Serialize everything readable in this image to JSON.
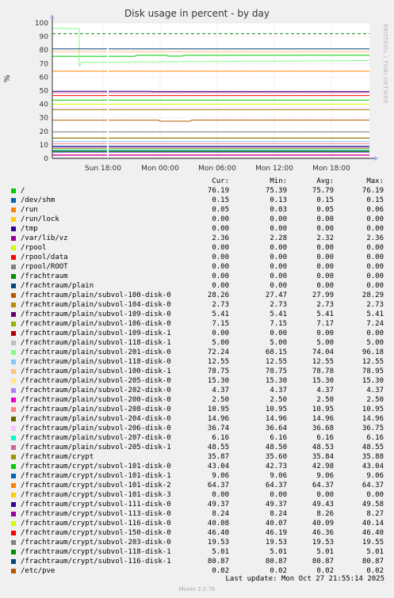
{
  "chart_data": {
    "type": "line",
    "title": "Disk usage in percent - by day",
    "ylabel": "%",
    "ylim": [
      0,
      100
    ],
    "y_ticks": [
      0,
      10,
      20,
      30,
      40,
      50,
      60,
      70,
      80,
      90,
      100
    ],
    "x_ticks": [
      "Sun 18:00",
      "Mon 00:00",
      "Mon 06:00",
      "Mon 12:00",
      "Mon 18:00"
    ],
    "grid": true,
    "side_label": "RRDTOOL / TOBI OETIKER",
    "columns": [
      "Cur:",
      "Min:",
      "Avg:",
      "Max:"
    ],
    "series": [
      {
        "name": "/",
        "color": "#00cc00",
        "cur": "76.19",
        "min": "75.39",
        "avg": "75.79",
        "max": "76.19"
      },
      {
        "name": "/dev/shm",
        "color": "#0066b3",
        "cur": "0.15",
        "min": "0.13",
        "avg": "0.15",
        "max": "0.15"
      },
      {
        "name": "/run",
        "color": "#ff8000",
        "cur": "0.05",
        "min": "0.03",
        "avg": "0.05",
        "max": "0.06"
      },
      {
        "name": "/run/lock",
        "color": "#ffcc00",
        "cur": "0.00",
        "min": "0.00",
        "avg": "0.00",
        "max": "0.00"
      },
      {
        "name": "/tmp",
        "color": "#330099",
        "cur": "0.00",
        "min": "0.00",
        "avg": "0.00",
        "max": "0.00"
      },
      {
        "name": "/var/lib/vz",
        "color": "#990099",
        "cur": "2.36",
        "min": "2.28",
        "avg": "2.32",
        "max": "2.36"
      },
      {
        "name": "/rpool",
        "color": "#ccff00",
        "cur": "0.00",
        "min": "0.00",
        "avg": "0.00",
        "max": "0.00"
      },
      {
        "name": "/rpool/data",
        "color": "#ff0000",
        "cur": "0.00",
        "min": "0.00",
        "avg": "0.00",
        "max": "0.00"
      },
      {
        "name": "/rpool/ROOT",
        "color": "#808080",
        "cur": "0.00",
        "min": "0.00",
        "avg": "0.00",
        "max": "0.00"
      },
      {
        "name": "/frachtraum",
        "color": "#008f00",
        "cur": "0.00",
        "min": "0.00",
        "avg": "0.00",
        "max": "0.00"
      },
      {
        "name": "/frachtraum/plain",
        "color": "#00487d",
        "cur": "0.00",
        "min": "0.00",
        "avg": "0.00",
        "max": "0.00"
      },
      {
        "name": "/frachtraum/plain/subvol-100-disk-0",
        "color": "#b35a00",
        "cur": "28.26",
        "min": "27.47",
        "avg": "27.99",
        "max": "28.29"
      },
      {
        "name": "/frachtraum/plain/subvol-104-disk-0",
        "color": "#b38f00",
        "cur": "2.73",
        "min": "2.73",
        "avg": "2.73",
        "max": "2.73"
      },
      {
        "name": "/frachtraum/plain/subvol-109-disk-0",
        "color": "#6b006b",
        "cur": "5.41",
        "min": "5.41",
        "avg": "5.41",
        "max": "5.41"
      },
      {
        "name": "/frachtraum/plain/subvol-106-disk-0",
        "color": "#8fb300",
        "cur": "7.15",
        "min": "7.15",
        "avg": "7.17",
        "max": "7.24"
      },
      {
        "name": "/frachtraum/plain/subvol-109-disk-1",
        "color": "#b30000",
        "cur": "0.00",
        "min": "0.00",
        "avg": "0.00",
        "max": "0.00"
      },
      {
        "name": "/frachtraum/plain/subvol-118-disk-1",
        "color": "#bebebe",
        "cur": "5.00",
        "min": "5.00",
        "avg": "5.00",
        "max": "5.00"
      },
      {
        "name": "/frachtraum/plain/subvol-201-disk-0",
        "color": "#80ff80",
        "cur": "72.24",
        "min": "68.15",
        "avg": "74.04",
        "max": "96.18"
      },
      {
        "name": "/frachtraum/plain/subvol-118-disk-0",
        "color": "#80c9ff",
        "cur": "12.55",
        "min": "12.55",
        "avg": "12.55",
        "max": "12.55"
      },
      {
        "name": "/frachtraum/plain/subvol-100-disk-1",
        "color": "#ffc080",
        "cur": "78.75",
        "min": "78.75",
        "avg": "78.78",
        "max": "78.95"
      },
      {
        "name": "/frachtraum/plain/subvol-205-disk-0",
        "color": "#ffe680",
        "cur": "15.30",
        "min": "15.30",
        "avg": "15.30",
        "max": "15.30"
      },
      {
        "name": "/frachtraum/plain/subvol-202-disk-0",
        "color": "#aa80ff",
        "cur": "4.37",
        "min": "4.37",
        "avg": "4.37",
        "max": "4.37"
      },
      {
        "name": "/frachtraum/plain/subvol-200-disk-0",
        "color": "#ee00cc",
        "cur": "2.50",
        "min": "2.50",
        "avg": "2.50",
        "max": "2.50"
      },
      {
        "name": "/frachtraum/plain/subvol-208-disk-0",
        "color": "#ff8080",
        "cur": "10.95",
        "min": "10.95",
        "avg": "10.95",
        "max": "10.95"
      },
      {
        "name": "/frachtraum/plain/subvol-204-disk-0",
        "color": "#666600",
        "cur": "14.96",
        "min": "14.96",
        "avg": "14.96",
        "max": "14.96"
      },
      {
        "name": "/frachtraum/plain/subvol-206-disk-0",
        "color": "#ffbfff",
        "cur": "36.74",
        "min": "36.64",
        "avg": "36.68",
        "max": "36.75"
      },
      {
        "name": "/frachtraum/plain/subvol-207-disk-0",
        "color": "#00ffcc",
        "cur": "6.16",
        "min": "6.16",
        "avg": "6.16",
        "max": "6.16"
      },
      {
        "name": "/frachtraum/plain/subvol-205-disk-1",
        "color": "#cc6699",
        "cur": "48.55",
        "min": "48.50",
        "avg": "48.53",
        "max": "48.55"
      },
      {
        "name": "/frachtraum/crypt",
        "color": "#999900",
        "cur": "35.87",
        "min": "35.60",
        "avg": "35.84",
        "max": "35.88"
      },
      {
        "name": "/frachtraum/crypt/subvol-101-disk-0",
        "color": "#00cc00",
        "cur": "43.04",
        "min": "42.73",
        "avg": "42.98",
        "max": "43.04"
      },
      {
        "name": "/frachtraum/crypt/subvol-101-disk-1",
        "color": "#0066b3",
        "cur": "9.06",
        "min": "9.06",
        "avg": "9.06",
        "max": "9.06"
      },
      {
        "name": "/frachtraum/crypt/subvol-101-disk-2",
        "color": "#ff8000",
        "cur": "64.37",
        "min": "64.37",
        "avg": "64.37",
        "max": "64.37"
      },
      {
        "name": "/frachtraum/crypt/subvol-101-disk-3",
        "color": "#ffcc00",
        "cur": "0.00",
        "min": "0.00",
        "avg": "0.00",
        "max": "0.00"
      },
      {
        "name": "/frachtraum/crypt/subvol-111-disk-0",
        "color": "#330099",
        "cur": "49.37",
        "min": "49.37",
        "avg": "49.43",
        "max": "49.58"
      },
      {
        "name": "/frachtraum/crypt/subvol-113-disk-0",
        "color": "#990099",
        "cur": "8.24",
        "min": "8.24",
        "avg": "8.26",
        "max": "8.27"
      },
      {
        "name": "/frachtraum/crypt/subvol-116-disk-0",
        "color": "#ccff00",
        "cur": "40.08",
        "min": "40.07",
        "avg": "40.09",
        "max": "40.14"
      },
      {
        "name": "/frachtraum/crypt/subvol-150-disk-0",
        "color": "#ff0000",
        "cur": "46.40",
        "min": "46.19",
        "avg": "46.36",
        "max": "46.40"
      },
      {
        "name": "/frachtraum/crypt/subvol-203-disk-0",
        "color": "#808080",
        "cur": "19.53",
        "min": "19.53",
        "avg": "19.53",
        "max": "19.55"
      },
      {
        "name": "/frachtraum/crypt/subvol-118-disk-1",
        "color": "#008f00",
        "cur": "5.01",
        "min": "5.01",
        "avg": "5.01",
        "max": "5.01"
      },
      {
        "name": "/frachtraum/crypt/subvol-116-disk-1",
        "color": "#00487d",
        "cur": "80.87",
        "min": "80.87",
        "avg": "80.87",
        "max": "80.87"
      },
      {
        "name": "/etc/pve",
        "color": "#b35a00",
        "cur": "0.02",
        "min": "0.02",
        "avg": "0.02",
        "max": "0.02"
      }
    ],
    "threshold": {
      "value": 92,
      "color": "#008f00",
      "style": "dashed"
    }
  },
  "footer": "Last update: Mon Oct 27 21:55:14 2025",
  "version": "Munin 2.0.76"
}
